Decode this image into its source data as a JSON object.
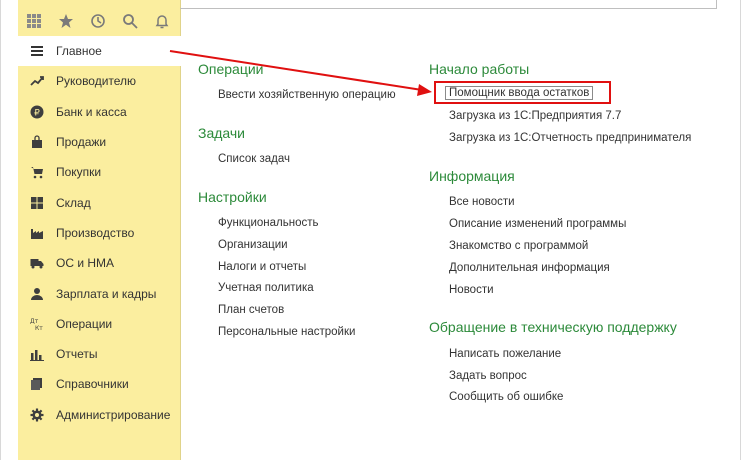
{
  "toolbar": {
    "icons": [
      "grid-icon",
      "star-icon",
      "history-icon",
      "search-icon",
      "bell-icon"
    ]
  },
  "sidebar": {
    "items": [
      {
        "label": "Главное",
        "icon": "menu-icon",
        "active": true
      },
      {
        "label": "Руководителю",
        "icon": "chart-trend-icon"
      },
      {
        "label": "Банк и касса",
        "icon": "ruble-icon"
      },
      {
        "label": "Продажи",
        "icon": "bag-icon"
      },
      {
        "label": "Покупки",
        "icon": "cart-icon"
      },
      {
        "label": "Склад",
        "icon": "warehouse-icon"
      },
      {
        "label": "Производство",
        "icon": "factory-icon"
      },
      {
        "label": "ОС и НМА",
        "icon": "truck-icon"
      },
      {
        "label": "Зарплата и кадры",
        "icon": "person-icon"
      },
      {
        "label": "Операции",
        "icon": "dt-kt-icon"
      },
      {
        "label": "Отчеты",
        "icon": "bar-chart-icon"
      },
      {
        "label": "Справочники",
        "icon": "books-icon"
      },
      {
        "label": "Администрирование",
        "icon": "gear-icon"
      }
    ]
  },
  "main": {
    "operations": {
      "title": "Операции",
      "links": [
        "Ввести хозяйственную операцию"
      ]
    },
    "tasks": {
      "title": "Задачи",
      "links": [
        "Список задач"
      ]
    },
    "settings": {
      "title": "Настройки",
      "links": [
        "Функциональность",
        "Организации",
        "Налоги и отчеты",
        "Учетная политика",
        "План счетов",
        "Персональные настройки"
      ]
    },
    "start": {
      "title": "Начало работы",
      "links": [
        "Помощник ввода остатков",
        "Загрузка из 1С:Предприятия 7.7",
        "Загрузка из 1С:Отчетность предпринимателя"
      ]
    },
    "info": {
      "title": "Информация",
      "links": [
        "Все новости",
        "Описание изменений программы",
        "Знакомство с программой",
        "Дополнительная информация",
        "Новости"
      ]
    },
    "support": {
      "title": "Обращение в техническую поддержку",
      "links": [
        "Написать пожелание",
        "Задать вопрос",
        "Сообщить об ошибке"
      ]
    }
  },
  "colors": {
    "sidebar": "#fbee9f",
    "section_title": "#2c8a3a",
    "annotation": "#e01010"
  }
}
